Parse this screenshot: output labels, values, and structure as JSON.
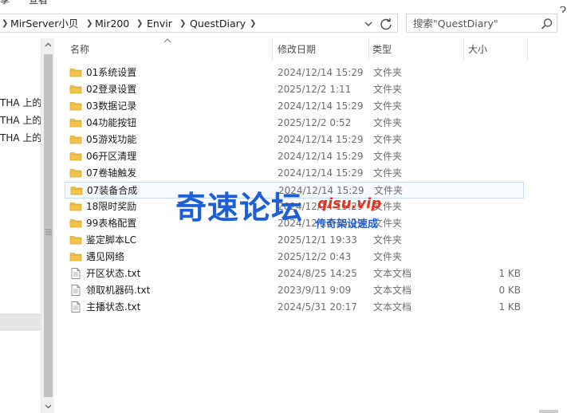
{
  "ribbon": {
    "items": [
      "享",
      "查看"
    ]
  },
  "address_bar": {
    "crumbs": [
      "MirServer小贝",
      "Mir200",
      "Envir",
      "QuestDiary"
    ]
  },
  "search": {
    "placeholder": "搜索\"QuestDiary\""
  },
  "nav": {
    "items": [
      "THA 上的",
      "THA 上的",
      "THA 上的"
    ]
  },
  "columns": {
    "name": "名称",
    "date": "修改日期",
    "type": "类型",
    "size": "大小"
  },
  "files": [
    {
      "name": "01系统设置",
      "date": "2024/12/14 15:29",
      "type": "文件夹",
      "size": "",
      "kind": "folder"
    },
    {
      "name": "02登录设置",
      "date": "2025/12/2 1:11",
      "type": "文件夹",
      "size": "",
      "kind": "folder"
    },
    {
      "name": "03数据记录",
      "date": "2024/12/14 15:29",
      "type": "文件夹",
      "size": "",
      "kind": "folder"
    },
    {
      "name": "04功能按钮",
      "date": "2025/12/2 0:52",
      "type": "文件夹",
      "size": "",
      "kind": "folder"
    },
    {
      "name": "05游戏功能",
      "date": "2024/12/14 15:29",
      "type": "文件夹",
      "size": "",
      "kind": "folder"
    },
    {
      "name": "06开区清理",
      "date": "2024/12/14 15:29",
      "type": "文件夹",
      "size": "",
      "kind": "folder"
    },
    {
      "name": "07卷轴触发",
      "date": "2024/12/14 15:29",
      "type": "文件夹",
      "size": "",
      "kind": "folder"
    },
    {
      "name": "07装备合成",
      "date": "2024/12/14 15:29",
      "type": "文件夹",
      "size": "",
      "kind": "folder"
    },
    {
      "name": "18限时奖励",
      "date": "2024/12/14 15:29",
      "type": "文件夹",
      "size": "",
      "kind": "folder"
    },
    {
      "name": "99表格配置",
      "date": "2024/12/14 15:29",
      "type": "文件夹",
      "size": "",
      "kind": "folder"
    },
    {
      "name": "鉴定脚本LC",
      "date": "2025/12/1 19:33",
      "type": "文件夹",
      "size": "",
      "kind": "folder"
    },
    {
      "name": "遇见网络",
      "date": "2025/12/2 0:43",
      "type": "文件夹",
      "size": "",
      "kind": "folder"
    },
    {
      "name": "开区状态.txt",
      "date": "2024/8/25 14:25",
      "type": "文本文档",
      "size": "1 KB",
      "kind": "text"
    },
    {
      "name": "领取机器码.txt",
      "date": "2023/9/11 9:09",
      "type": "文本文档",
      "size": "0 KB",
      "kind": "text"
    },
    {
      "name": "主播状态.txt",
      "date": "2024/5/31 20:17",
      "type": "文本文档",
      "size": "1 KB",
      "kind": "text"
    }
  ],
  "watermark": {
    "main": "奇速论坛",
    "url": "qisu.vip",
    "sub": "传奇架设速成"
  },
  "colors": {
    "folder": "#f0c34b",
    "folder_dark": "#dba52b",
    "hover_bg": "#f7fafe",
    "hover_border": "#c8dcf5",
    "watermark_blue": "#1f5fd6",
    "watermark_red": "#e8321e"
  }
}
